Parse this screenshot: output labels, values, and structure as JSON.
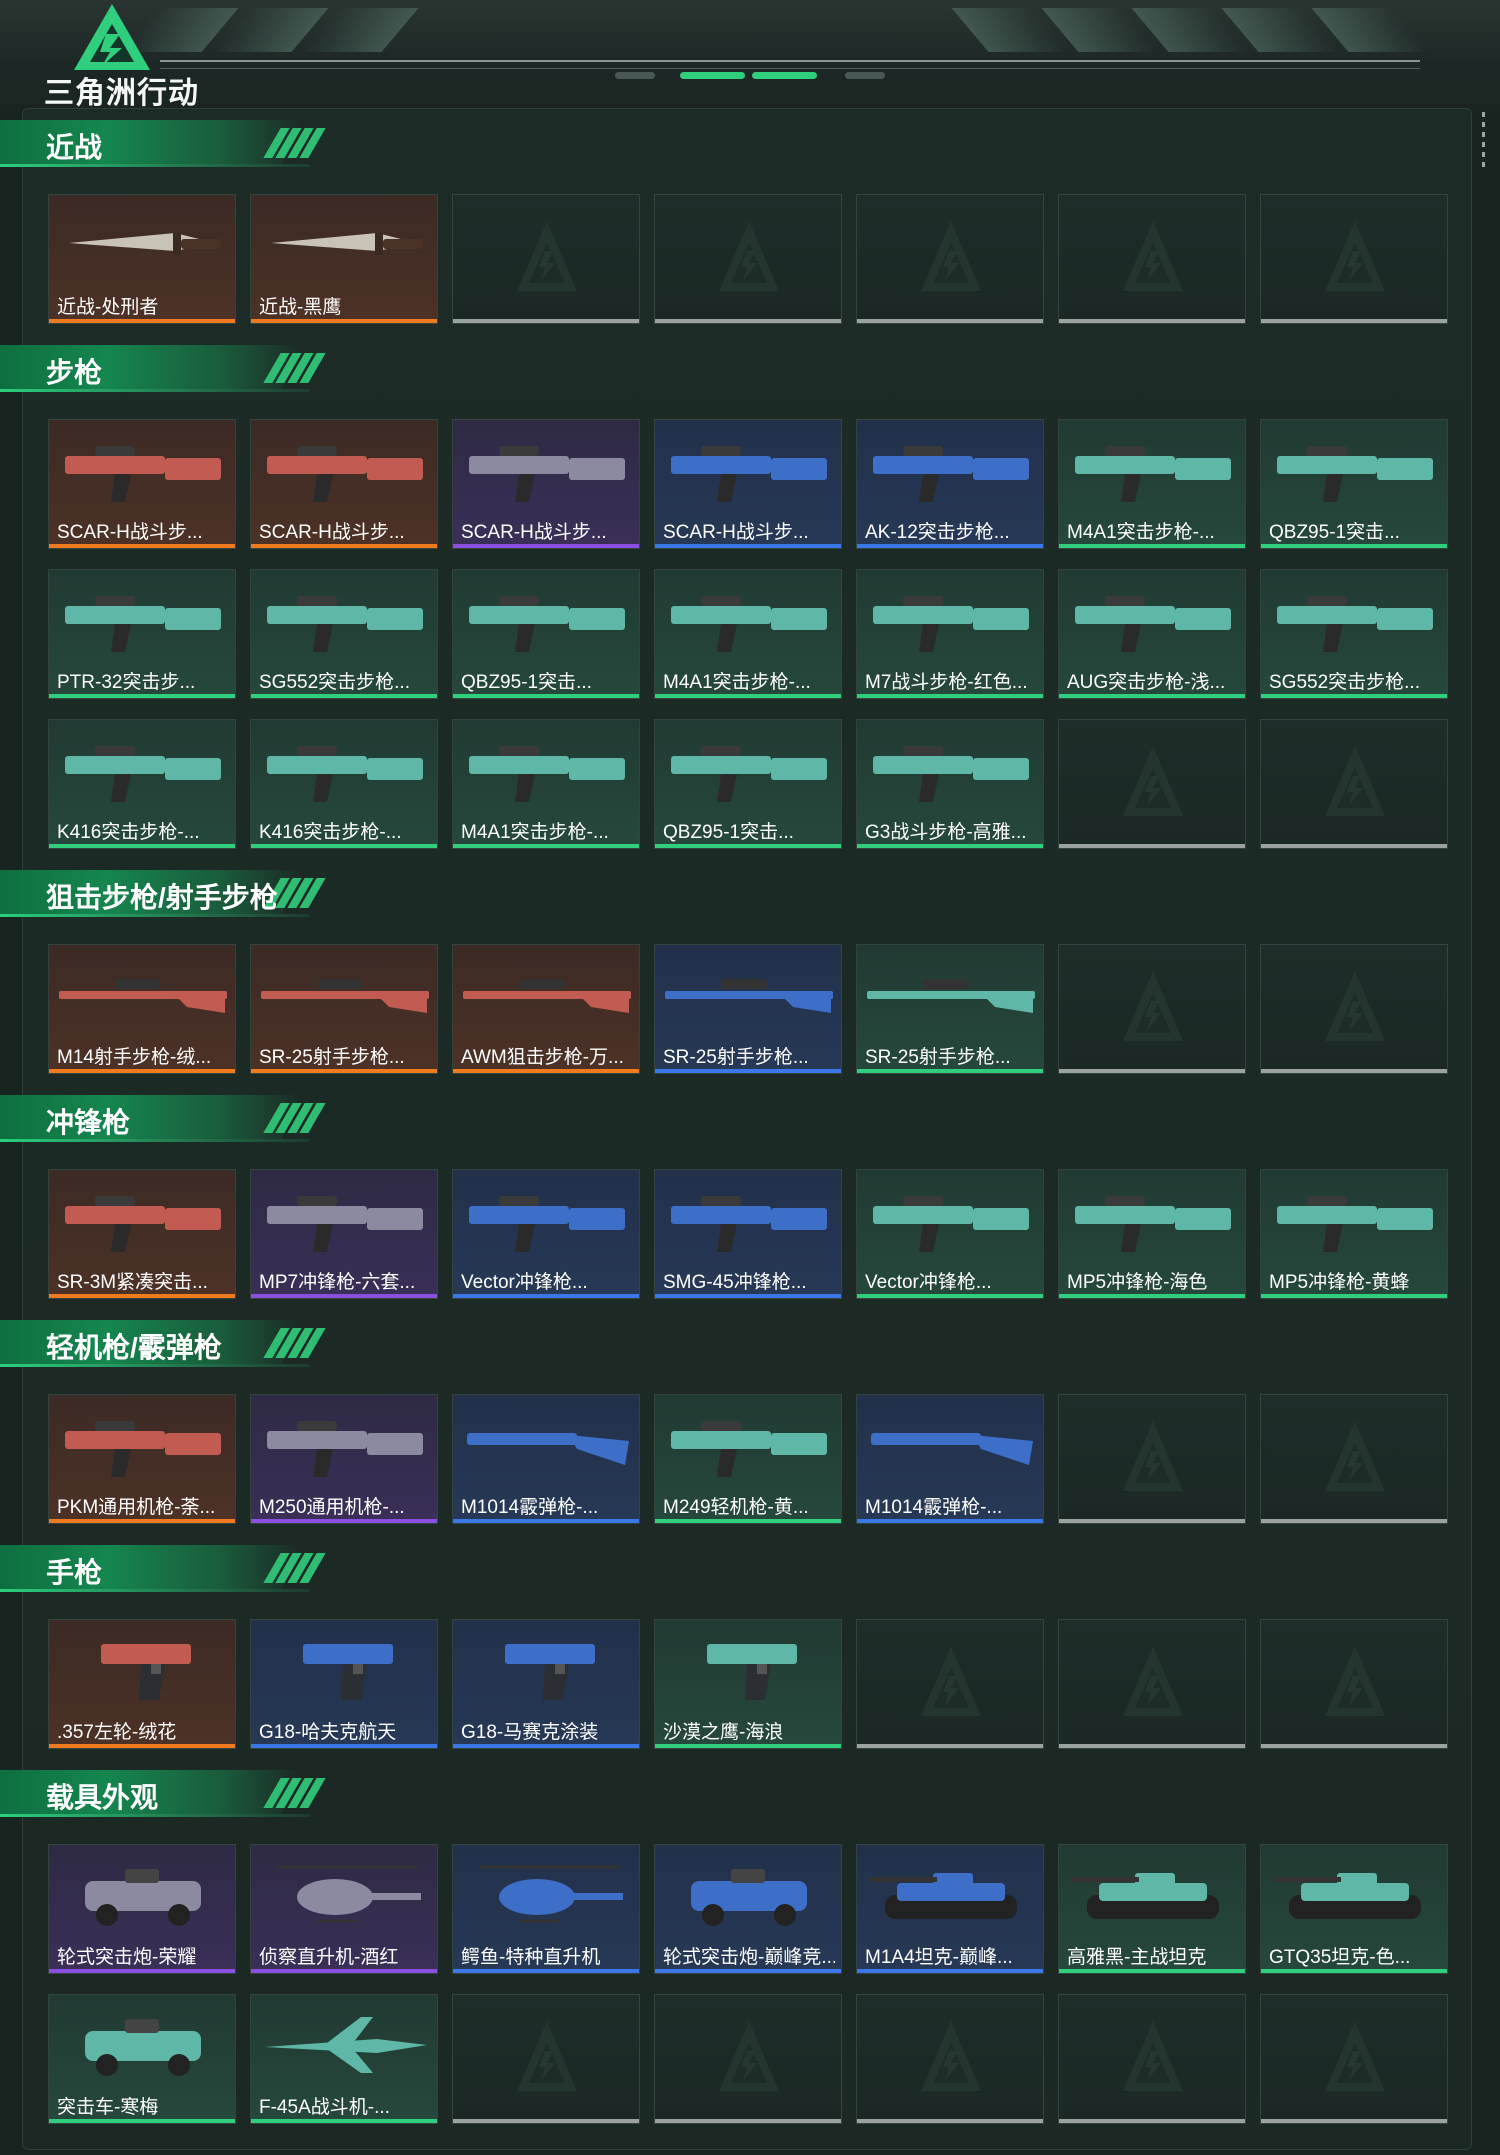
{
  "app": {
    "logo_text": "三角洲行动",
    "accent": "#2fcf7d"
  },
  "rarity_colors": {
    "orange": "#f07a1e",
    "purple": "#8a4fe0",
    "blue": "#3a78e8",
    "green": "#2fcf7d",
    "gray": "#9aa39f"
  },
  "sections": [
    {
      "title": "近战",
      "items": [
        {
          "label": "近战-处刑者",
          "rarity": "orange",
          "icon": "knife-icon"
        },
        {
          "label": "近战-黑鹰",
          "rarity": "orange",
          "icon": "knife-icon"
        },
        {
          "label": "",
          "rarity": "gray",
          "icon": "empty-slot-icon"
        },
        {
          "label": "",
          "rarity": "gray",
          "icon": "empty-slot-icon"
        },
        {
          "label": "",
          "rarity": "gray",
          "icon": "empty-slot-icon"
        },
        {
          "label": "",
          "rarity": "gray",
          "icon": "empty-slot-icon"
        },
        {
          "label": "",
          "rarity": "gray",
          "icon": "empty-slot-icon"
        }
      ]
    },
    {
      "title": "步枪",
      "items": [
        {
          "label": "SCAR-H战斗步...",
          "rarity": "orange",
          "icon": "rifle-icon"
        },
        {
          "label": "SCAR-H战斗步...",
          "rarity": "orange",
          "icon": "rifle-icon"
        },
        {
          "label": "SCAR-H战斗步...",
          "rarity": "purple",
          "icon": "rifle-icon"
        },
        {
          "label": "SCAR-H战斗步...",
          "rarity": "blue",
          "icon": "rifle-icon"
        },
        {
          "label": "AK-12突击步枪...",
          "rarity": "blue",
          "icon": "rifle-icon"
        },
        {
          "label": "M4A1突击步枪-...",
          "rarity": "green",
          "icon": "rifle-icon"
        },
        {
          "label": "QBZ95-1突击...",
          "rarity": "green",
          "icon": "rifle-icon"
        },
        {
          "label": "PTR-32突击步...",
          "rarity": "green",
          "icon": "rifle-icon"
        },
        {
          "label": "SG552突击步枪...",
          "rarity": "green",
          "icon": "rifle-icon"
        },
        {
          "label": "QBZ95-1突击...",
          "rarity": "green",
          "icon": "rifle-icon"
        },
        {
          "label": "M4A1突击步枪-...",
          "rarity": "green",
          "icon": "rifle-icon"
        },
        {
          "label": "M7战斗步枪-红色...",
          "rarity": "green",
          "icon": "rifle-icon"
        },
        {
          "label": "AUG突击步枪-浅...",
          "rarity": "green",
          "icon": "rifle-icon"
        },
        {
          "label": "SG552突击步枪...",
          "rarity": "green",
          "icon": "rifle-icon"
        },
        {
          "label": "K416突击步枪-...",
          "rarity": "green",
          "icon": "rifle-icon"
        },
        {
          "label": "K416突击步枪-...",
          "rarity": "green",
          "icon": "rifle-icon"
        },
        {
          "label": "M4A1突击步枪-...",
          "rarity": "green",
          "icon": "rifle-icon"
        },
        {
          "label": "QBZ95-1突击...",
          "rarity": "green",
          "icon": "rifle-icon"
        },
        {
          "label": "G3战斗步枪-高雅...",
          "rarity": "green",
          "icon": "rifle-icon"
        },
        {
          "label": "",
          "rarity": "gray",
          "icon": "empty-slot-icon"
        },
        {
          "label": "",
          "rarity": "gray",
          "icon": "empty-slot-icon"
        }
      ]
    },
    {
      "title": "狙击步枪/射手步枪",
      "items": [
        {
          "label": "M14射手步枪-绒...",
          "rarity": "orange",
          "icon": "sniper-icon"
        },
        {
          "label": "SR-25射手步枪...",
          "rarity": "orange",
          "icon": "sniper-icon"
        },
        {
          "label": "AWM狙击步枪-万...",
          "rarity": "orange",
          "icon": "sniper-icon"
        },
        {
          "label": "SR-25射手步枪...",
          "rarity": "blue",
          "icon": "sniper-icon"
        },
        {
          "label": "SR-25射手步枪...",
          "rarity": "green",
          "icon": "sniper-icon"
        },
        {
          "label": "",
          "rarity": "gray",
          "icon": "empty-slot-icon"
        },
        {
          "label": "",
          "rarity": "gray",
          "icon": "empty-slot-icon"
        }
      ]
    },
    {
      "title": "冲锋枪",
      "items": [
        {
          "label": "SR-3M紧凑突击...",
          "rarity": "orange",
          "icon": "smg-icon"
        },
        {
          "label": "MP7冲锋枪-六套...",
          "rarity": "purple",
          "icon": "smg-icon"
        },
        {
          "label": "Vector冲锋枪...",
          "rarity": "blue",
          "icon": "smg-icon"
        },
        {
          "label": "SMG-45冲锋枪...",
          "rarity": "blue",
          "icon": "smg-icon"
        },
        {
          "label": "Vector冲锋枪...",
          "rarity": "green",
          "icon": "smg-icon"
        },
        {
          "label": "MP5冲锋枪-海色",
          "rarity": "green",
          "icon": "smg-icon"
        },
        {
          "label": "MP5冲锋枪-黄蜂",
          "rarity": "green",
          "icon": "smg-icon"
        }
      ]
    },
    {
      "title": "轻机枪/霰弹枪",
      "items": [
        {
          "label": "PKM通用机枪-荼...",
          "rarity": "orange",
          "icon": "lmg-icon"
        },
        {
          "label": "M250通用机枪-...",
          "rarity": "purple",
          "icon": "lmg-icon"
        },
        {
          "label": "M1014霰弹枪-...",
          "rarity": "blue",
          "icon": "shotgun-icon"
        },
        {
          "label": "M249轻机枪-黄...",
          "rarity": "green",
          "icon": "lmg-icon"
        },
        {
          "label": "M1014霰弹枪-...",
          "rarity": "blue",
          "icon": "shotgun-icon"
        },
        {
          "label": "",
          "rarity": "gray",
          "icon": "empty-slot-icon"
        },
        {
          "label": "",
          "rarity": "gray",
          "icon": "empty-slot-icon"
        }
      ]
    },
    {
      "title": "手枪",
      "items": [
        {
          "label": ".357左轮-绒花",
          "rarity": "orange",
          "icon": "pistol-icon"
        },
        {
          "label": "G18-哈夫克航天",
          "rarity": "blue",
          "icon": "pistol-icon"
        },
        {
          "label": "G18-马赛克涂装",
          "rarity": "blue",
          "icon": "pistol-icon"
        },
        {
          "label": "沙漠之鹰-海浪",
          "rarity": "green",
          "icon": "pistol-icon"
        },
        {
          "label": "",
          "rarity": "gray",
          "icon": "empty-slot-icon"
        },
        {
          "label": "",
          "rarity": "gray",
          "icon": "empty-slot-icon"
        },
        {
          "label": "",
          "rarity": "gray",
          "icon": "empty-slot-icon"
        }
      ]
    },
    {
      "title": "载具外观",
      "items": [
        {
          "label": "轮式突击炮-荣耀",
          "rarity": "purple",
          "icon": "armored-vehicle-icon"
        },
        {
          "label": "侦察直升机-酒红",
          "rarity": "purple",
          "icon": "helicopter-icon"
        },
        {
          "label": "鳄鱼-特种直升机",
          "rarity": "blue",
          "icon": "helicopter-icon"
        },
        {
          "label": "轮式突击炮-巅峰竞...",
          "rarity": "blue",
          "icon": "armored-vehicle-icon"
        },
        {
          "label": "M1A4坦克-巅峰...",
          "rarity": "blue",
          "icon": "tank-icon"
        },
        {
          "label": "高雅黑-主战坦克",
          "rarity": "green",
          "icon": "tank-icon"
        },
        {
          "label": "GTQ35坦克-色...",
          "rarity": "green",
          "icon": "tank-icon"
        },
        {
          "label": "突击车-寒梅",
          "rarity": "green",
          "icon": "armored-vehicle-icon"
        },
        {
          "label": "F-45A战斗机-...",
          "rarity": "green",
          "icon": "fighter-jet-icon"
        },
        {
          "label": "",
          "rarity": "gray",
          "icon": "empty-slot-icon"
        },
        {
          "label": "",
          "rarity": "gray",
          "icon": "empty-slot-icon"
        },
        {
          "label": "",
          "rarity": "gray",
          "icon": "empty-slot-icon"
        },
        {
          "label": "",
          "rarity": "gray",
          "icon": "empty-slot-icon"
        },
        {
          "label": "",
          "rarity": "gray",
          "icon": "empty-slot-icon"
        }
      ]
    }
  ]
}
